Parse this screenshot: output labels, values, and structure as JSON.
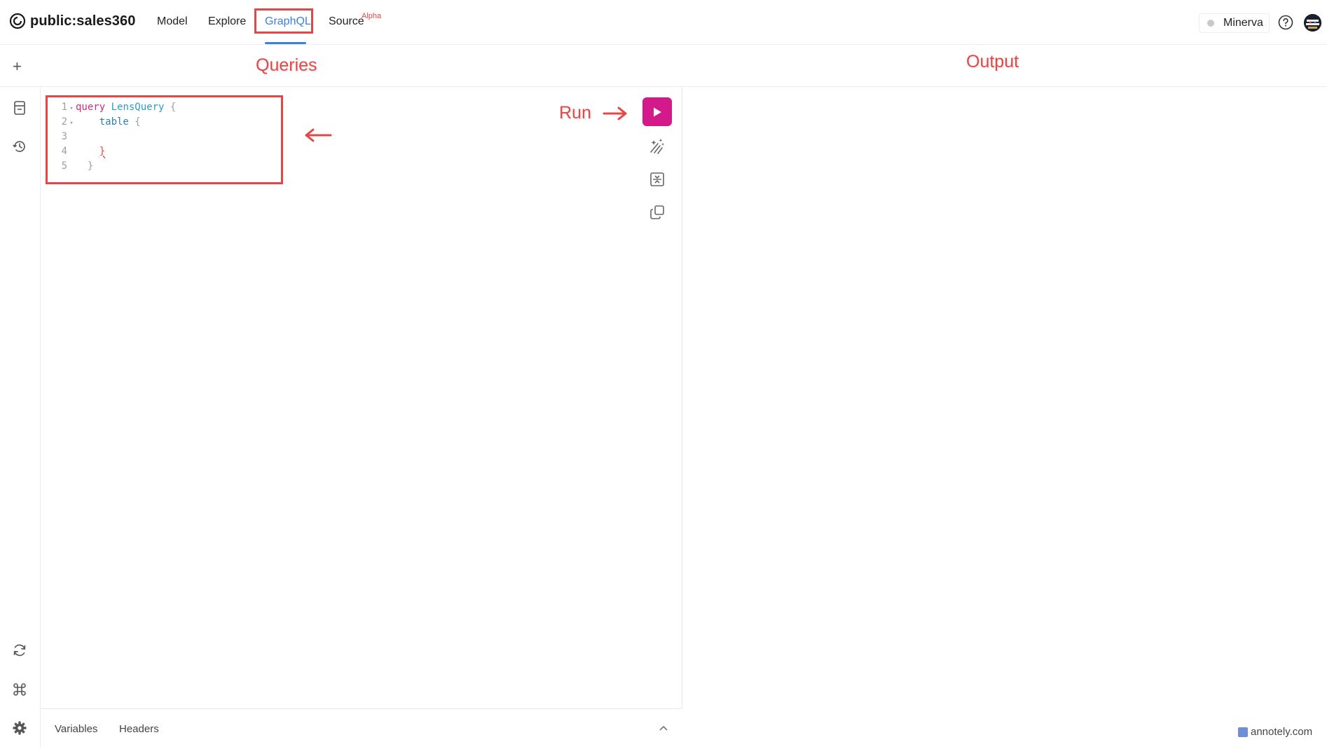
{
  "header": {
    "brand": "public:sales360",
    "nav": {
      "model": "Model",
      "explore": "Explore",
      "graphql": "GraphQL",
      "source": "Source",
      "source_badge": "Alpha"
    },
    "active_tab": "GraphQL",
    "accent_color": "#3b7fe0",
    "user_status_label": "Minerva",
    "icons": [
      "logo-icon",
      "help-icon",
      "avatar"
    ]
  },
  "subbar": {
    "add_icon": "plus-icon"
  },
  "sidebar": {
    "top_icons": [
      "saved-queries-icon",
      "history-icon"
    ],
    "bottom_icons": [
      "refresh-icon",
      "command-icon",
      "settings-icon"
    ]
  },
  "editor": {
    "lines": [
      {
        "num": "1",
        "fold": "▾",
        "parts": [
          {
            "t": "query",
            "c": "kw"
          },
          {
            "t": " ",
            "c": ""
          },
          {
            "t": "LensQuery",
            "c": "name"
          },
          {
            "t": " {",
            "c": "brace"
          }
        ]
      },
      {
        "num": "2",
        "fold": "▾",
        "parts": [
          {
            "t": "    ",
            "c": ""
          },
          {
            "t": "table",
            "c": "field"
          },
          {
            "t": " {",
            "c": "brace"
          }
        ]
      },
      {
        "num": "3",
        "fold": "",
        "parts": []
      },
      {
        "num": "4",
        "fold": "",
        "parts": [
          {
            "t": "    ",
            "c": ""
          },
          {
            "t": "}",
            "c": "err"
          }
        ]
      },
      {
        "num": "5",
        "fold": "",
        "parts": [
          {
            "t": "  }",
            "c": "brace"
          }
        ]
      }
    ],
    "toolbar": [
      "run-button",
      "prettify-icon",
      "merge-fragments-icon",
      "copy-icon"
    ],
    "run_color": "#d4198a"
  },
  "bottom_tabs": {
    "variables": "Variables",
    "headers": "Headers"
  },
  "annotations": {
    "queries": "Queries",
    "output": "Output",
    "run": "Run",
    "color": "#e24848"
  },
  "watermark": "annotely.com"
}
